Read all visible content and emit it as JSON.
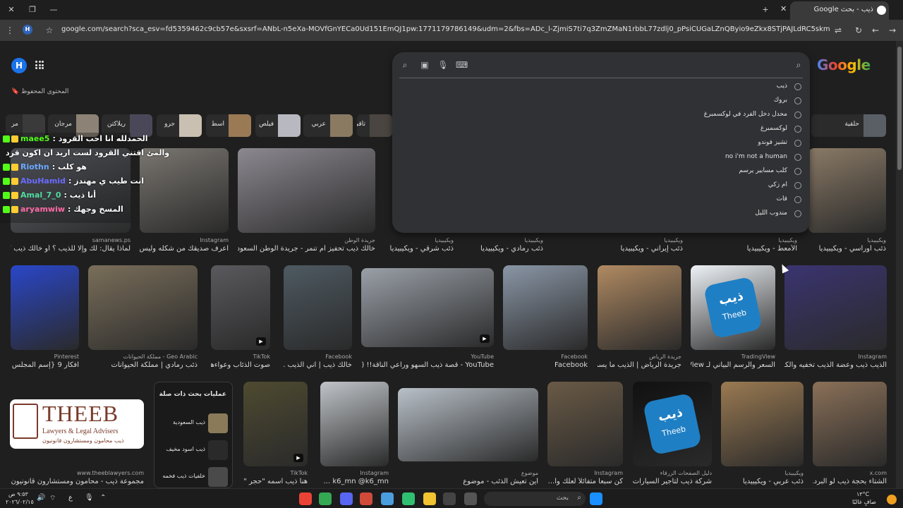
{
  "browser": {
    "tab_title": "ذيب - بحث Google",
    "url": "google.com/search?sca_esv=fd5359462c9cb57e&sxsrf=ANbL-n5eXa-MOVfGnYECa0Ud151EmQJ1pw:1771179786149&udm=2&fbs=ADc_l-ZjmiS7ti7q3ZmZMaN1rbbL77zdlj0_pPsiCUGaLZnQByio9eZkx8STjPAJLdRC5skmnb8QtrrgAjOjjnQDOkcOjLtHWhxFmPwpV0xb...",
    "profile_initial": "H"
  },
  "header": {
    "avatar_initial": "H",
    "saved_label": "المحتوى المحفوظ",
    "logo_text": "Google"
  },
  "suggestions": [
    "ذيب",
    "بروك",
    "محدل دخل الفرد في لوكسمبرغ",
    "لوكسمبرغ",
    "تشيز فوندو",
    "no i'm not a human",
    "كلب مسابير يرسم",
    "ام زكي",
    "قات",
    "مندوب الليل"
  ],
  "chips": [
    {
      "label": "حلقية",
      "color": "#5a5f66"
    },
    {
      "label": "تاقي",
      "color": "#4a4540"
    },
    {
      "label": "عربي",
      "color": "#8a7a62"
    },
    {
      "label": "فيلص",
      "color": "#b8b8c0"
    },
    {
      "label": "اسط",
      "color": "#9a7a55"
    },
    {
      "label": "جرو",
      "color": "#c9c0b2"
    },
    {
      "label": "ريلاكتن",
      "color": "#4a4858"
    },
    {
      "label": "مرجان",
      "color": "#8c8275"
    },
    {
      "label": "مر",
      "color": "#3a3a3a"
    }
  ],
  "chat": [
    {
      "user": "maee5",
      "text": ": الحمدلله انا احب القرود",
      "user_color": "#53fc18"
    },
    {
      "user": "",
      "text": "والمئ اقتني القرود لست اريد ان اكون قرد",
      "user_color": "#ffffff"
    },
    {
      "user": "Riothn",
      "text": ": هو كلب",
      "user_color": "#6aa7ff"
    },
    {
      "user": "AbuHamid",
      "text": ": انت طيب ي مهندز",
      "user_color": "#6a6aff"
    },
    {
      "user": "Amal_7_0",
      "text": ": أنا ذيب",
      "user_color": "#53d9a0"
    },
    {
      "user": "aryamwiw",
      "text": ": المسخ وجهك",
      "user_color": "#ff6aa7"
    }
  ],
  "row1": [
    {
      "src": "samanews.ps",
      "title": "لماذا يقال: لك وإلا للذيب ؟ أو خالك ذيب ؟ لما...",
      "color": "#6a6f78"
    },
    {
      "src": "Instagram",
      "title": "اعرف صديقك من شكله وليس م...",
      "color": "#7a7670"
    },
    {
      "src": "جريدة الوطن",
      "title": "خالك ذيب تحفيز أم تنمر - جريدة الوطن السعودية",
      "color": "#8c8890"
    },
    {
      "src": "ويكيبيديا",
      "title": "ذئب شرقي - ويكيبيديا",
      "color": "#6e6a64"
    },
    {
      "src": "ويكيبيديا",
      "title": "ذئب رمادي - ويكيبيديا",
      "color": "#7e7a72"
    },
    {
      "src": "ويكيبيديا",
      "title": "ذئب إيراني - ويكيبيديا",
      "color": "#8a7e6a"
    },
    {
      "src": "ويكيبيديا",
      "title": "الأمعط - ويكيبيديا",
      "color": "#7a7268"
    },
    {
      "src": "ويكيبيديا",
      "title": "ذئب أوراسي - ويكيبيديا",
      "color": "#8a7a66"
    }
  ],
  "row2": [
    {
      "src": "Pinterest",
      "title": "أفكار 9 {إسم المجلس } ...",
      "color": "#2a46c8"
    },
    {
      "src": "Geo Arabic - مملكة الحيوانات",
      "title": "ذئب رمادي | مملكة الحيوانات",
      "color": "#7a6e5a"
    },
    {
      "src": "TikTok",
      "title": "صوت الذئاب وعواءها...",
      "color": "#5a5a5e"
    },
    {
      "src": "Facebook",
      "title": "خالك ذيب | أني الذيب ...",
      "color": "#4e5a62"
    },
    {
      "src": "YouTube",
      "title": "YouTube - قصة ذيب السهو وراعي الناقة!! ( ٥",
      "color": "#9aa0a8"
    },
    {
      "src": "Facebook",
      "title": "Facebook",
      "color": "#8a96a6"
    },
    {
      "src": "جريدة الرياض",
      "title": "جريدة الرياض | الذيب ما يسر...",
      "color": "#b08a62"
    },
    {
      "src": "TradingView",
      "title": "السعر والرسم البياني لـ TradingView",
      "color": "#eef2f6"
    },
    {
      "src": "Instagram",
      "title": "الذيب ذيب وعضة الذيب تخفيه والكا...",
      "color": "#3a3470"
    }
  ],
  "theeb_logo": {
    "name": "THEEB",
    "sub": "Lawyers & Legal Advisers",
    "ar": "ذيب  محامون ومستشارون قانونيون"
  },
  "row3": [
    {
      "src": "www.theeblawyers.com",
      "title": "مجموعة ذيب - محامون ومستشارون قانونيون",
      "color": "#ffffff"
    },
    {
      "src": "TikTok",
      "title": "هنا ذيب اسمه \"حجر \"...",
      "color": "#4e4a30"
    },
    {
      "src": "Instagram",
      "title": "k6_mn @k6_mn ...",
      "color": "#c0c4c8"
    },
    {
      "src": "موضوع",
      "title": "أين تعيش الذئب - موضوع",
      "color": "#b8c0c8"
    },
    {
      "src": "Instagram",
      "title": "كن سبعاً متفائلاً لعلك وأ...",
      "color": "#6a5a46"
    },
    {
      "src": "دليل الصفحات الزرقاء",
      "title": "شركة ذيب لتأجير السيارات...",
      "color": "#111111"
    },
    {
      "src": "ويكيبيديا",
      "title": "ذئب عربي - ويكيبيديا",
      "color": "#9a7a52"
    },
    {
      "src": "x.com",
      "title": "الشتاء بحجة ذيب لو البرد...",
      "color": "#8a7058"
    }
  ],
  "related": {
    "heading": "عمليات بحث ذات صلة",
    "items": [
      {
        "label": "ذيب السعودية",
        "color": "#8a7a5a"
      },
      {
        "label": "ذيب اسود مخيف",
        "color": "#2a2a2a"
      },
      {
        "label": "خلفيات ذيب فخمه",
        "color": "#4a4a4a"
      }
    ]
  },
  "tv_brand": {
    "ar": "ذيب",
    "en": "Theeb",
    "color": "#1f7fc4"
  },
  "taskbar": {
    "search_placeholder": "بحث",
    "time": "٩:٥٣ ص",
    "date": "٢٠٢٦/٠٢/١٥",
    "weather": "١٣°C",
    "weather_desc": "صافٍ غالبًا",
    "lang": "ع"
  }
}
